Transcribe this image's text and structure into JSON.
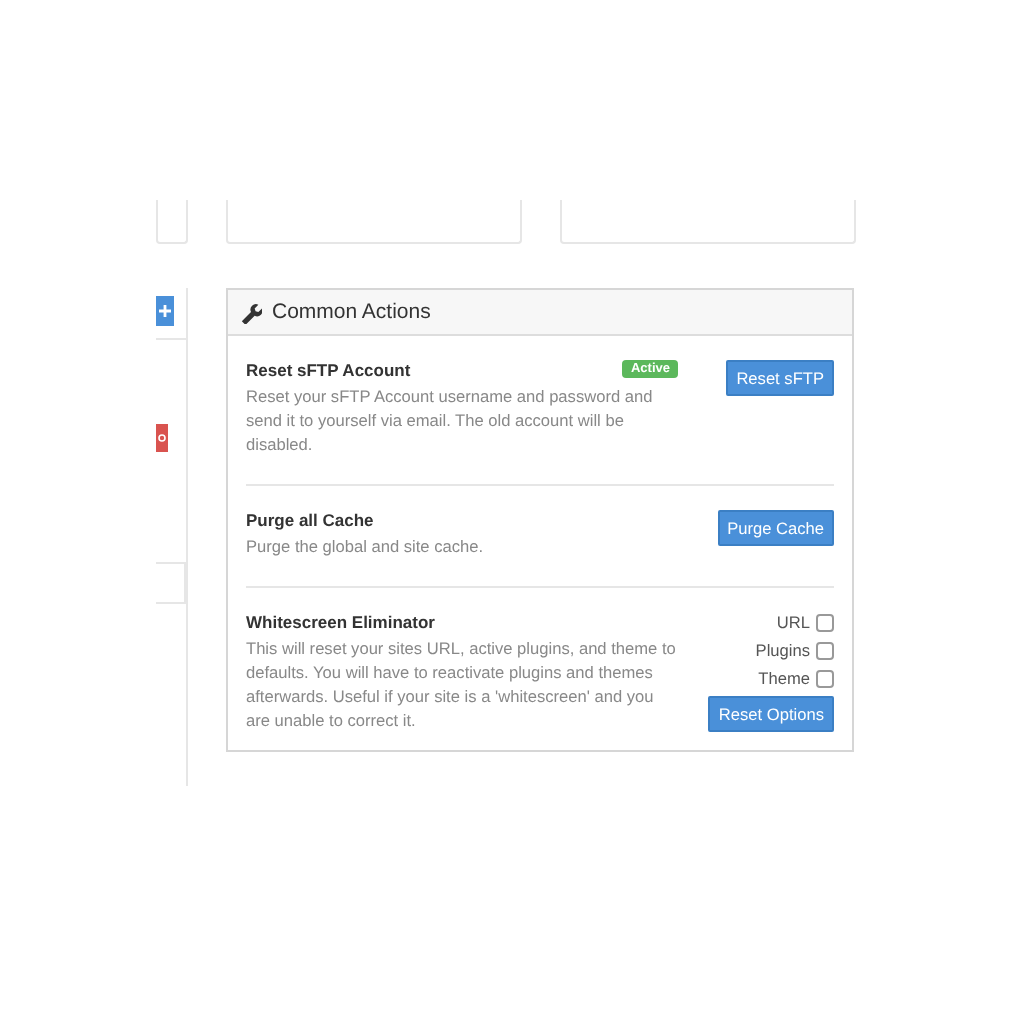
{
  "panel": {
    "title": "Common Actions"
  },
  "actions": [
    {
      "kind": "button",
      "title": "Reset sFTP Account",
      "badge": "Active",
      "description": "Reset your sFTP Account username and password and send it to yourself via email. The old account will be disabled.",
      "button": "Reset sFTP"
    },
    {
      "kind": "button",
      "title": "Purge all Cache",
      "description": "Purge the global and site cache.",
      "button": "Purge Cache"
    },
    {
      "kind": "options",
      "title": "Whitescreen Eliminator",
      "description": "This will reset your sites URL, active plugins, and theme to defaults. You will have to reactivate plugins and themes afterwards. Useful if your site is a 'whitescreen' and you are unable to correct it.",
      "options": [
        {
          "label": "URL",
          "checked": false
        },
        {
          "label": "Plugins",
          "checked": false
        },
        {
          "label": "Theme",
          "checked": false
        }
      ],
      "button": "Reset Options"
    }
  ]
}
